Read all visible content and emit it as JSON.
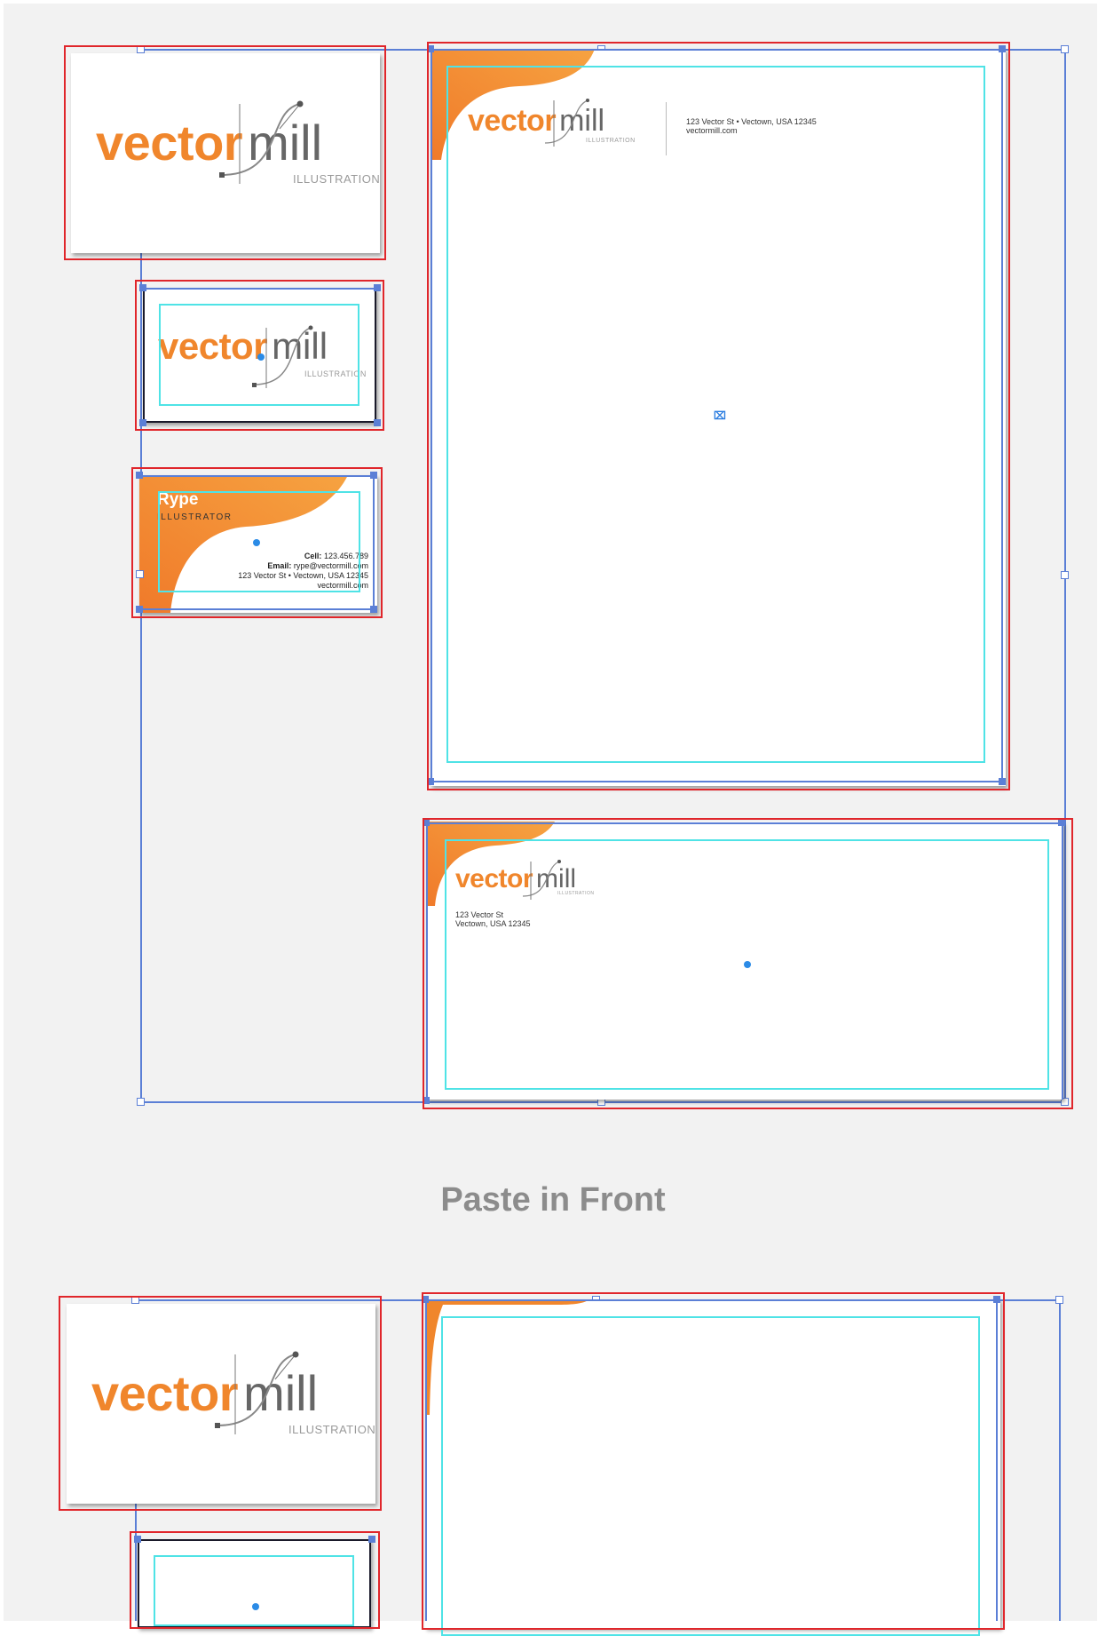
{
  "caption": "Paste in Front",
  "logo": {
    "word1": "vector",
    "word2": "mill",
    "sub": "ILLUSTRATION"
  },
  "business_card": {
    "name": "Rype",
    "role": "ILLUSTRATOR",
    "cell_label": "Cell:",
    "cell_value": "123.456.789",
    "email_label": "Email:",
    "email_value": "rype@vectormill.com",
    "address": "123 Vector St • Vectown, USA 12345",
    "website": "vectormill.com"
  },
  "letterhead": {
    "address_line": "123 Vector St • Vectown, USA 12345",
    "website": "vectormill.com"
  },
  "envelope": {
    "line1": "123 Vector St",
    "line2": "Vectown, USA 12345"
  },
  "colors": {
    "selection_red": "#e0262b",
    "bounding_blue": "#5b7fd6",
    "bleed_cyan": "#4fe3e6",
    "brand_orange": "#f0862c",
    "canvas": "#f2f2f2"
  }
}
